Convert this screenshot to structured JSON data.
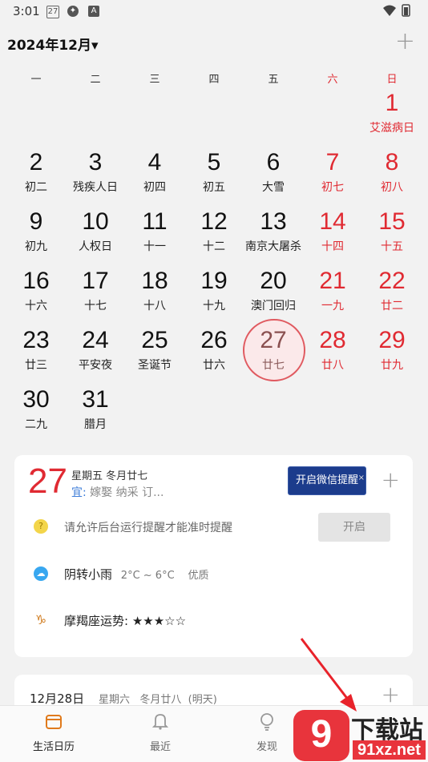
{
  "status_bar": {
    "time": "3:01",
    "icons": [
      "calendar-icon",
      "settings-icon",
      "app-icon"
    ],
    "right_icons": [
      "wifi-icon",
      "battery-icon"
    ]
  },
  "header": {
    "month_title": "2024年12月",
    "dropdown_icon": "▾",
    "add_label": "+"
  },
  "weekdays": [
    "一",
    "二",
    "三",
    "四",
    "五",
    "六",
    "日"
  ],
  "calendar": [
    {
      "day": "1",
      "lunar": "艾滋病日",
      "red": true,
      "today": false
    },
    {
      "day": "2",
      "lunar": "初二",
      "red": false,
      "today": false
    },
    {
      "day": "3",
      "lunar": "残疾人日",
      "red": false,
      "today": false
    },
    {
      "day": "4",
      "lunar": "初四",
      "red": false,
      "today": false
    },
    {
      "day": "5",
      "lunar": "初五",
      "red": false,
      "today": false
    },
    {
      "day": "6",
      "lunar": "大雪",
      "red": false,
      "today": false
    },
    {
      "day": "7",
      "lunar": "初七",
      "red": true,
      "today": false
    },
    {
      "day": "8",
      "lunar": "初八",
      "red": true,
      "today": false
    },
    {
      "day": "9",
      "lunar": "初九",
      "red": false,
      "today": false
    },
    {
      "day": "10",
      "lunar": "人权日",
      "red": false,
      "today": false
    },
    {
      "day": "11",
      "lunar": "十一",
      "red": false,
      "today": false
    },
    {
      "day": "12",
      "lunar": "十二",
      "red": false,
      "today": false
    },
    {
      "day": "13",
      "lunar": "南京大屠杀",
      "red": false,
      "today": false
    },
    {
      "day": "14",
      "lunar": "十四",
      "red": true,
      "today": false
    },
    {
      "day": "15",
      "lunar": "十五",
      "red": true,
      "today": false
    },
    {
      "day": "16",
      "lunar": "十六",
      "red": false,
      "today": false
    },
    {
      "day": "17",
      "lunar": "十七",
      "red": false,
      "today": false
    },
    {
      "day": "18",
      "lunar": "十八",
      "red": false,
      "today": false
    },
    {
      "day": "19",
      "lunar": "十九",
      "red": false,
      "today": false
    },
    {
      "day": "20",
      "lunar": "澳门回归",
      "red": false,
      "today": false
    },
    {
      "day": "21",
      "lunar": "一九",
      "red": true,
      "today": false
    },
    {
      "day": "22",
      "lunar": "廿二",
      "red": true,
      "today": false
    },
    {
      "day": "23",
      "lunar": "廿三",
      "red": false,
      "today": false
    },
    {
      "day": "24",
      "lunar": "平安夜",
      "red": false,
      "today": false
    },
    {
      "day": "25",
      "lunar": "圣诞节",
      "red": false,
      "today": false
    },
    {
      "day": "26",
      "lunar": "廿六",
      "red": false,
      "today": false
    },
    {
      "day": "27",
      "lunar": "廿七",
      "red": false,
      "today": true
    },
    {
      "day": "28",
      "lunar": "廿八",
      "red": true,
      "today": false
    },
    {
      "day": "29",
      "lunar": "廿九",
      "red": true,
      "today": false
    },
    {
      "day": "30",
      "lunar": "二九",
      "red": false,
      "today": false
    },
    {
      "day": "31",
      "lunar": "腊月",
      "red": false,
      "today": false
    }
  ],
  "today_card": {
    "big_day": "27",
    "date_line": "星期五 冬月廿七",
    "yi_label": "宜:",
    "yi_text": " 嫁娶 纳采 订...",
    "wechat_button": "开启微信提醒",
    "wechat_close": "×",
    "add_label": "+",
    "notice_text": "请允许后台运行提醒才能准时提醒",
    "notice_icon_glyph": "?",
    "open_button": "开启",
    "weather_main": "阴转小雨",
    "weather_range": "2°C ~ 6°C",
    "weather_quality": "优质",
    "weather_icon_glyph": "☁",
    "horoscope": "摩羯座运势: ★★★☆☆",
    "horoscope_icon_glyph": "♑"
  },
  "next_card": {
    "date": "12月28日",
    "sub": "星期六   冬月廿八  (明天)",
    "add_label": "+"
  },
  "bottom_nav": [
    {
      "label": "生活日历",
      "icon": "calendar-icon",
      "glyph": "▦",
      "active": true
    },
    {
      "label": "最近",
      "icon": "bell-icon",
      "glyph": "🔔",
      "active": false
    },
    {
      "label": "发现",
      "icon": "lightbulb-icon",
      "glyph": "☼",
      "active": false
    }
  ],
  "watermark": {
    "logo": "9",
    "text_top": "下载站",
    "text_bottom": "91xz.net"
  },
  "colors": {
    "red": "#e02a32",
    "blue_button": "#1c3c8c",
    "background": "#f2f2f2",
    "arrow": "#e8222a"
  }
}
